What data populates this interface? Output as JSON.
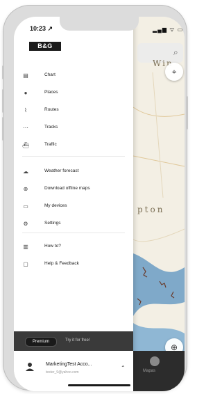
{
  "status_bar": {
    "time": "10:23 ↗",
    "icons": "▂▄▆ ᯤ ▭"
  },
  "drawer": {
    "logo": "B&G",
    "groups": [
      [
        {
          "label": "Chart",
          "icon": "chart-icon",
          "glyph": "▤"
        },
        {
          "label": "Places",
          "icon": "pin-icon",
          "glyph": "●"
        },
        {
          "label": "Routes",
          "icon": "route-icon",
          "glyph": "⌇"
        },
        {
          "label": "Tracks",
          "icon": "track-icon",
          "glyph": "⋯"
        },
        {
          "label": "Traffic",
          "icon": "boat-icon",
          "glyph": "⛴"
        }
      ],
      [
        {
          "label": "Weather forecast",
          "icon": "cloud-icon",
          "glyph": "☁"
        },
        {
          "label": "Download offline maps",
          "icon": "download-icon",
          "glyph": "⊕"
        },
        {
          "label": "My devices",
          "icon": "monitor-icon",
          "glyph": "▭"
        },
        {
          "label": "Settings",
          "icon": "gear-icon",
          "glyph": "⚙"
        }
      ],
      [
        {
          "label": "How to?",
          "icon": "book-icon",
          "glyph": "▥"
        },
        {
          "label": "Help & Feedback",
          "icon": "chat-icon",
          "glyph": "▢"
        }
      ]
    ],
    "premium": {
      "badge": "Premium",
      "cta": "Try it for free!"
    },
    "account": {
      "name": "MarketingTest Acco...",
      "email": "tester_9@yahoo.com",
      "chevron": "⌃"
    }
  },
  "map": {
    "place_labels": [
      "Win",
      "pton"
    ],
    "search_icon": "search-icon",
    "tab_label": "Mapas"
  },
  "colors": {
    "drawer_bg": "#ffffff",
    "premium_bar": "#3a3a3a",
    "water": "#7fa9c9",
    "land": "#f3efe4"
  }
}
